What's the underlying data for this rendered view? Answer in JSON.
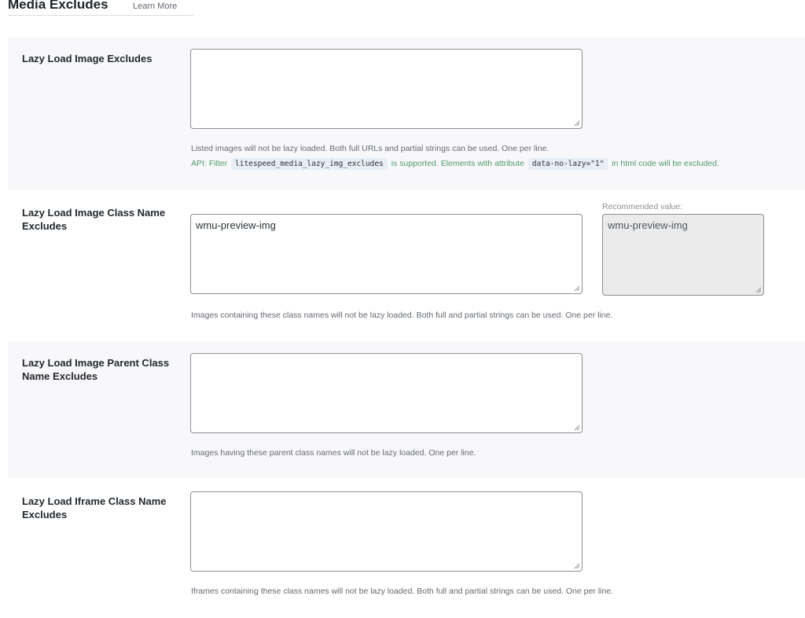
{
  "header": {
    "title": "Media Excludes",
    "learn_more": "Learn More"
  },
  "settings": [
    {
      "label": "Lazy Load Image Excludes",
      "value": "",
      "description": "Listed images will not be lazy loaded. Both full URLs and partial strings can be used. One per line.",
      "api": {
        "prefix": "API: Filter",
        "filter_code": "litespeed_media_lazy_img_excludes",
        "middle": "is supported. Elements with attribute",
        "attribute_code": "data-no-lazy=\"1\"",
        "suffix": "in html code will be excluded."
      }
    },
    {
      "label": "Lazy Load Image Class Name Excludes",
      "value": "wmu-preview-img",
      "recommended_label": "Recommended value:",
      "recommended_value": "wmu-preview-img",
      "description": "Images containing these class names will not be lazy loaded. Both full and partial strings can be used. One per line."
    },
    {
      "label": "Lazy Load Image Parent Class Name Excludes",
      "value": "",
      "description": "Images having these parent class names will not be lazy loaded. One per line."
    },
    {
      "label": "Lazy Load Iframe Class Name Excludes",
      "value": "",
      "description": "Iframes containing these class names will not be lazy loaded. Both full and partial strings can be used. One per line."
    }
  ],
  "colors": {
    "row_shade": "#f8f8fa",
    "api_text": "#4e9a6b",
    "code_bg": "#e8eef5",
    "recommended_bg": "#ebebeb"
  }
}
